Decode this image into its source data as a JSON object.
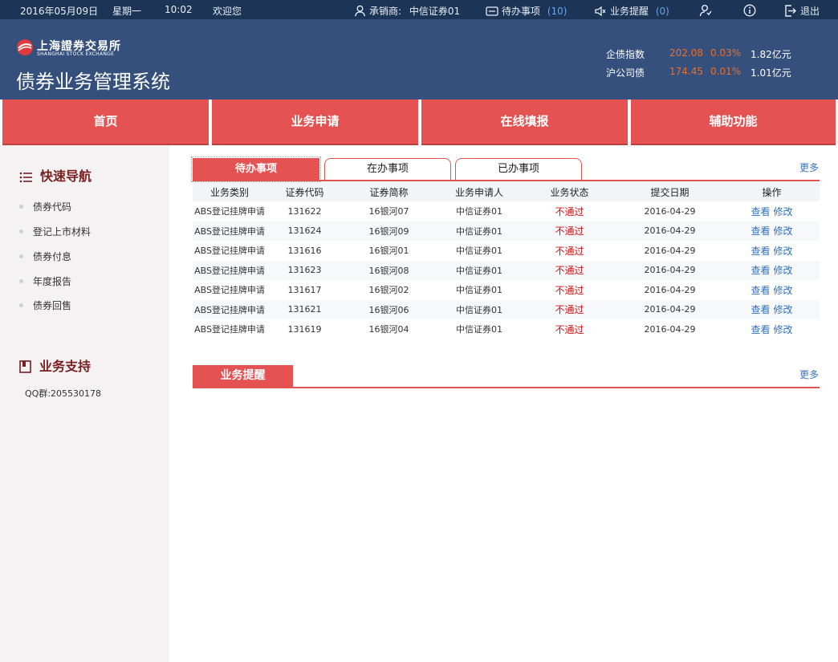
{
  "topbar": {
    "date": "2016年05月09日",
    "weekday": "星期一",
    "time": "10:02",
    "welcome": "欢迎您",
    "underwriter_label": "承销商:",
    "underwriter_name": "中信证券01",
    "todo_label": "待办事项",
    "todo_count": "(10)",
    "reminder_label": "业务提醒",
    "reminder_count": "(0)",
    "logout_label": "退出"
  },
  "header": {
    "logo_cn": "上海證券交易所",
    "logo_en": "SHANGHAI STOCK EXCHANGE",
    "system_title": "债券业务管理系统",
    "indices": [
      {
        "name": "企债指数",
        "value": "202.08",
        "change": "0.03%",
        "turnover": "1.82亿元"
      },
      {
        "name": "沪公司债",
        "value": "174.45",
        "change": "0.01%",
        "turnover": "1.01亿元"
      }
    ],
    "accent_color": "#e86f2c"
  },
  "nav": {
    "items": [
      "首页",
      "业务申请",
      "在线填报",
      "辅助功能"
    ],
    "color": "#e45252"
  },
  "sidebar": {
    "quick_nav_title": "快速导航",
    "quick_nav_items": [
      "债券代码",
      "登记上市材料",
      "债券付息",
      "年度报告",
      "债券回售"
    ],
    "support_title": "业务支持",
    "qq_text": "QQ群:205530178"
  },
  "tasks": {
    "tabs": [
      "待办事项",
      "在办事项",
      "已办事项"
    ],
    "more_label": "更多",
    "columns": [
      "业务类别",
      "证券代码",
      "证券简称",
      "业务申请人",
      "业务状态",
      "提交日期",
      "操作"
    ],
    "rows": [
      {
        "type": "ABS登记挂牌申请",
        "code": "131622",
        "name": "16银河07",
        "applicant": "中信证券01",
        "status": "不通过",
        "date": "2016-04-29"
      },
      {
        "type": "ABS登记挂牌申请",
        "code": "131624",
        "name": "16银河09",
        "applicant": "中信证券01",
        "status": "不通过",
        "date": "2016-04-29"
      },
      {
        "type": "ABS登记挂牌申请",
        "code": "131616",
        "name": "16银河01",
        "applicant": "中信证券01",
        "status": "不通过",
        "date": "2016-04-29"
      },
      {
        "type": "ABS登记挂牌申请",
        "code": "131623",
        "name": "16银河08",
        "applicant": "中信证券01",
        "status": "不通过",
        "date": "2016-04-29"
      },
      {
        "type": "ABS登记挂牌申请",
        "code": "131617",
        "name": "16银河02",
        "applicant": "中信证券01",
        "status": "不通过",
        "date": "2016-04-29"
      },
      {
        "type": "ABS登记挂牌申请",
        "code": "131621",
        "name": "16银河06",
        "applicant": "中信证券01",
        "status": "不通过",
        "date": "2016-04-29"
      },
      {
        "type": "ABS登记挂牌申请",
        "code": "131619",
        "name": "16银河04",
        "applicant": "中信证券01",
        "status": "不通过",
        "date": "2016-04-29"
      }
    ],
    "view_label": "查看",
    "edit_label": "修改"
  },
  "reminders": {
    "tab_label": "业务提醒",
    "more_label": "更多"
  }
}
